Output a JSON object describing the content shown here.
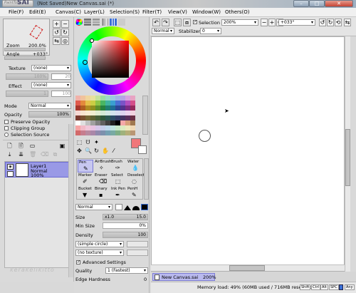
{
  "titlebar": {
    "logo_small": "PaintTool",
    "logo_big": "SAI",
    "title": "(Not Saved)New Canvas.sai (*)",
    "min": "–",
    "max": "□",
    "close": "✕"
  },
  "menubar": {
    "items": [
      "File(F)",
      "Edit(E)",
      "Canvas(C)",
      "Layer(L)",
      "Selection(S)",
      "Filter(T)",
      "View(V)",
      "Window(W)",
      "Others(O)"
    ]
  },
  "navigator": {
    "zoom_label": "Zoom",
    "zoom_value": "200.0%",
    "angle_label": "Angle",
    "angle_value": "+033°"
  },
  "texture": {
    "texture_label": "Texture",
    "texture_value": "(none)",
    "scale_label": "Scale",
    "scale_value": "100%",
    "scale_num": "20",
    "effect_label": "Effect",
    "effect_value": "(none)",
    "width_label": "Width",
    "width_num": "1",
    "width_num2": "100"
  },
  "layerprops": {
    "mode_label": "Mode",
    "mode_value": "Normal",
    "opacity_label": "Opacity",
    "opacity_value": "100%",
    "preserve_opacity": "Preserve Opacity",
    "clipping_group": "Clipping Group",
    "selection_source": "Selection Source"
  },
  "layer": {
    "name": "Layer1",
    "mode": "Normal",
    "opacity": "100%"
  },
  "watermark": "kerakelikitto",
  "toolbar": {
    "selection_label": "Selection",
    "zoom_value": "200%",
    "minus": "−",
    "plus": "+",
    "reset": "↺",
    "angle_value": "+033°",
    "normal_value": "Normal",
    "stabilizer_label": "Stabilizer",
    "stabilizer_value": "0"
  },
  "colors": {
    "selected_swatch": "#f0777a",
    "swatches": [
      "#f1b2a9",
      "#f1c29c",
      "#f0d59c",
      "#e6e29d",
      "#c4e29c",
      "#9cdca4",
      "#9cd8c7",
      "#9ccbe0",
      "#a5b3e8",
      "#b7a4e6",
      "#d9a3e0",
      "#e8a3c2",
      "#e05b4c",
      "#e3893c",
      "#e5c04a",
      "#cbcd44",
      "#8cc446",
      "#49b662",
      "#3fb39f",
      "#3a9fd1",
      "#4a6fd3",
      "#7a53c7",
      "#b24fbe",
      "#d44f8a",
      "#a8372c",
      "#b05d22",
      "#b08c23",
      "#8f901f",
      "#5d8f2c",
      "#27823d",
      "#1f7f71",
      "#1f6d96",
      "#2d4697",
      "#51338f",
      "#7d2c85",
      "#962a5c",
      "#f6d8d4",
      "#f7e3cf",
      "#f7ecd1",
      "#f1efd0",
      "#e0eed0",
      "#d1ebd3",
      "#d1e9e2",
      "#d1e3ee",
      "#d5dbf1",
      "#ddd3f0",
      "#ecd2ee",
      "#f1d2df",
      "#7a3a30",
      "#7a5030",
      "#756836",
      "#606434",
      "#48623a",
      "#2e5a3a",
      "#2a5a52",
      "#2b4d67",
      "#323d68",
      "#443464",
      "#5a2f5d",
      "#6a2f45",
      "#ffffff",
      "#e0e0e0",
      "#c0c0c0",
      "#a0a0a0",
      "#808080",
      "#606060",
      "#404040",
      "#202020",
      "#000000",
      "#f4a9a9",
      "#d7a07a",
      "#a0784f",
      "#f6a3a3",
      "#f2b9c6",
      "#f1c7d9",
      "#e8c2e2",
      "#d7c6ea",
      "#c5cdea",
      "#bdd8ec",
      "#bfe4e0",
      "#c6e8c8",
      "#dbecc1",
      "#eee9bd",
      "#f1d9b6",
      "#d26a6a",
      "#c77d8e",
      "#b98aa0",
      "#aa86a8",
      "#8f89ad",
      "#7d90ad",
      "#74a0b2",
      "#78aaa4",
      "#7fae86",
      "#9fb27c",
      "#b6ae78",
      "#b99674"
    ]
  },
  "tools": {
    "labels": [
      "Pen",
      "AirBrush",
      "Brush",
      "Water",
      "Marker",
      "Eraser",
      "Select",
      "Deselect",
      "Bucket",
      "Binary",
      "Ink Pen",
      "PenH"
    ]
  },
  "brush": {
    "mode_value": "Normal",
    "size_label": "Size",
    "size_mult": "x1.0",
    "size_value": "15.0",
    "minsize_label": "Min Size",
    "minsize_value": "0%",
    "density_label": "Density",
    "density_value": "100",
    "shape_value": "(simple circle)",
    "texture_value": "(no texture)",
    "advanced_label": "Advanced Settings",
    "quality_label": "Quality",
    "quality_value": "1 (Fastest)",
    "edge_label": "Edge Hardness",
    "edge_value": "0"
  },
  "status": {
    "tab_name": "New Canvas.sai",
    "tab_zoom": "200%",
    "memory": "Memory load: 49% (60MB used / 716MB reserved)",
    "keys": [
      "Shift",
      "Ctrl",
      "Alt",
      "SPC",
      "Any"
    ]
  }
}
